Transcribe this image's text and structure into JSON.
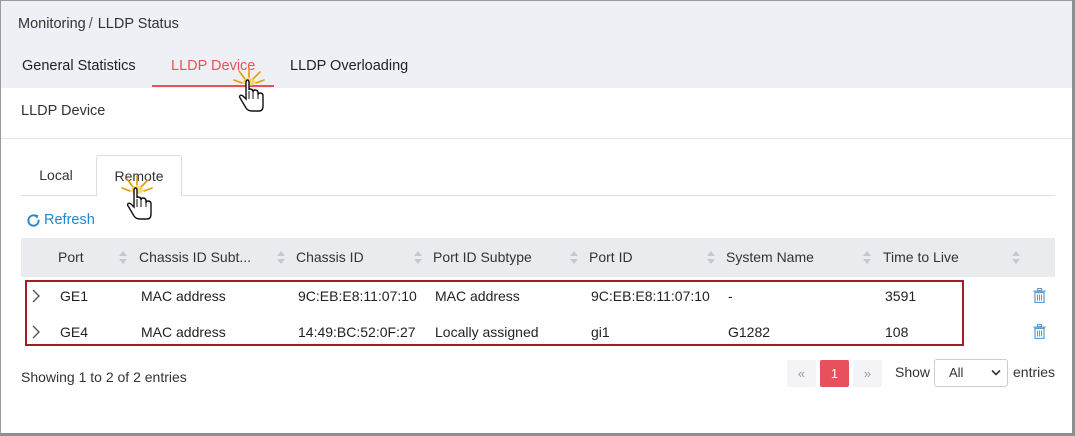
{
  "breadcrumb": {
    "parent": "Monitoring",
    "separator": "/",
    "current": "LLDP Status"
  },
  "main_tabs": [
    {
      "label": "General Statistics",
      "active": false
    },
    {
      "label": "LLDP Device",
      "active": true
    },
    {
      "label": "LLDP Overloading",
      "active": false
    }
  ],
  "section": {
    "title": "LLDP Device"
  },
  "sub_tabs": [
    {
      "label": "Local",
      "active": false
    },
    {
      "label": "Remote",
      "active": true
    }
  ],
  "toolbar": {
    "refresh_label": "Refresh",
    "refresh_icon": "refresh-icon"
  },
  "table": {
    "columns": [
      "Port",
      "Chassis ID Subt...",
      "Chassis ID",
      "Port ID Subtype",
      "Port ID",
      "System Name",
      "Time to Live"
    ],
    "rows": [
      {
        "port": "GE1",
        "chassis_subtype": "MAC address",
        "chassis_id": "9C:EB:E8:11:07:10",
        "port_subtype": "MAC address",
        "port_id": "9C:EB:E8:11:07:10",
        "system_name": "-",
        "ttl": "3591"
      },
      {
        "port": "GE4",
        "chassis_subtype": "MAC address",
        "chassis_id": "14:49:BC:52:0F:27",
        "port_subtype": "Locally assigned",
        "port_id": "gi1",
        "system_name": "G1282",
        "ttl": "108"
      }
    ]
  },
  "footer": {
    "summary": "Showing 1 to 2 of 2 entries",
    "pager": {
      "prev": "«",
      "current": "1",
      "next": "»"
    },
    "show_label": "Show",
    "page_size": "All",
    "entries_label": "entries"
  },
  "colors": {
    "accent": "#e8505b",
    "link": "#1e88c8",
    "highlight": "#a01e2a",
    "header_bg": "#eff0f5"
  }
}
